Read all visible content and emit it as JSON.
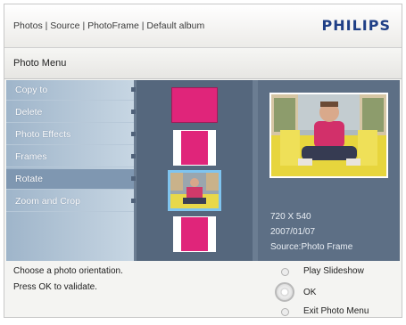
{
  "header": {
    "breadcrumb": "Photos | Source | PhotoFrame | Default album",
    "logo": "PHILIPS",
    "logo_color": "#1f3f86"
  },
  "menu": {
    "title": "Photo Menu",
    "items": [
      {
        "label": "Copy to",
        "selected": false
      },
      {
        "label": "Delete",
        "selected": false
      },
      {
        "label": "Photo Effects",
        "selected": false
      },
      {
        "label": "Frames",
        "selected": false
      },
      {
        "label": "Rotate",
        "selected": true
      },
      {
        "label": "Zoom and Crop",
        "selected": false
      }
    ]
  },
  "orientations": [
    {
      "name": "landscape",
      "selected": false
    },
    {
      "name": "portrait",
      "selected": false
    },
    {
      "name": "original",
      "selected": true
    },
    {
      "name": "portrait",
      "selected": false
    }
  ],
  "photo_info": {
    "resolution": "720 X 540",
    "date": "2007/01/07",
    "source": "Source:Photo Frame"
  },
  "footer": {
    "help_line1": "Choose a photo orientation.",
    "help_line2": "Press OK to validate.",
    "options": [
      {
        "label": "Play Slideshow",
        "icon": "small-button-icon"
      },
      {
        "label": "OK",
        "icon": "ok-button-icon"
      },
      {
        "label": "Exit Photo Menu",
        "icon": "small-button-icon"
      }
    ]
  },
  "colors": {
    "accent_pink": "#e0257a",
    "selection_blue": "#7fc4ef",
    "sidebar_blue": "#9fb5ca"
  }
}
